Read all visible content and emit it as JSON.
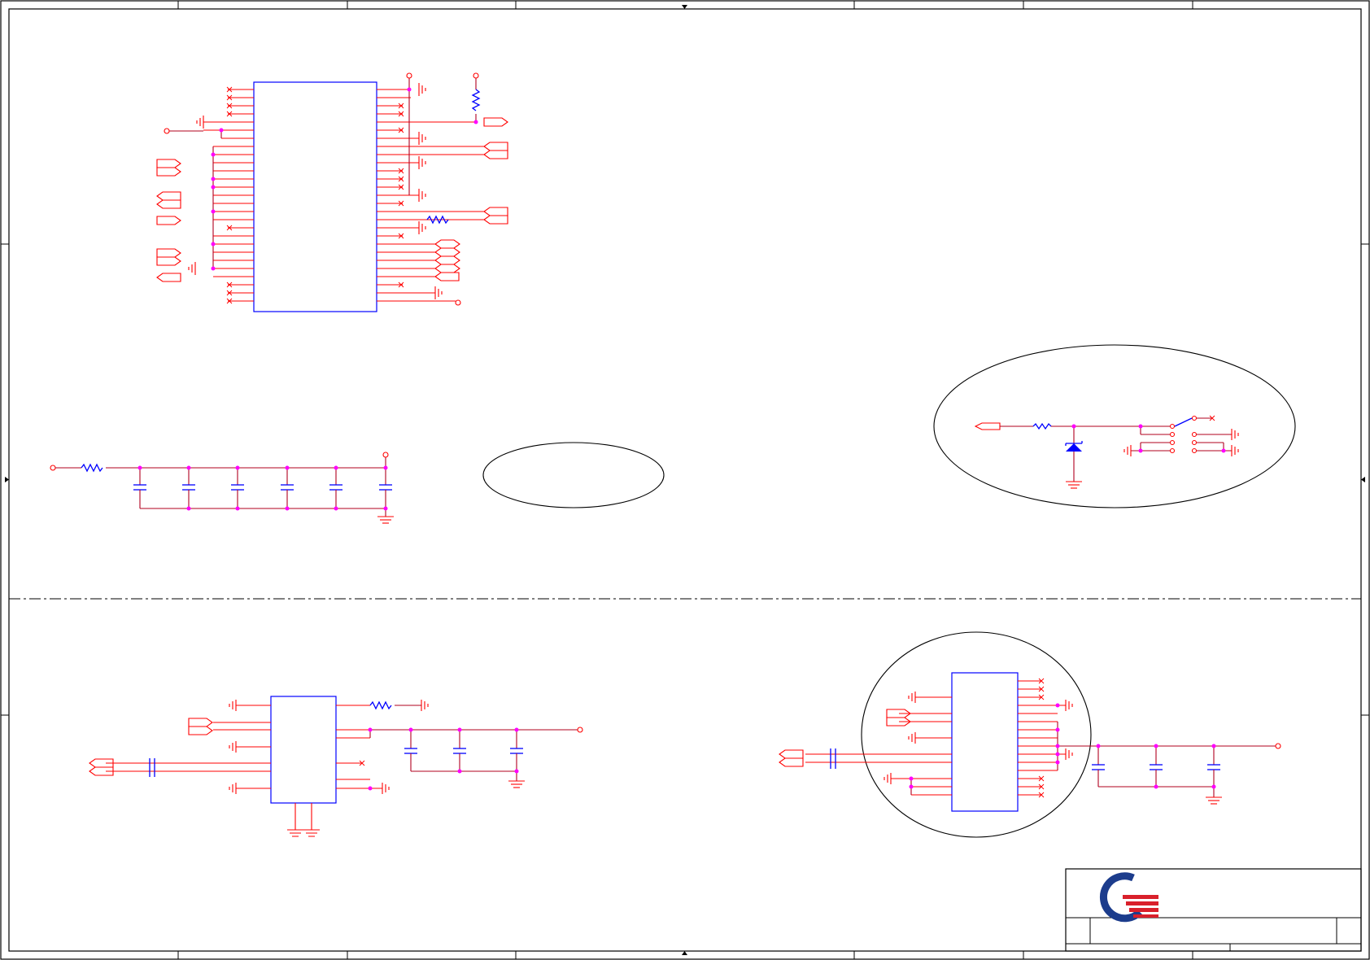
{
  "sheet": {
    "background": "#ffffff",
    "frame_color": "#000000",
    "wire_color": "#b0001e",
    "pin_color": "#ff0000",
    "part_body_color": "#0000ff",
    "junction_color": "#ff00ff"
  },
  "title_block": {
    "logo": "company-logo-q",
    "logo_colors": [
      "#1c3c8c",
      "#d9202b"
    ]
  }
}
